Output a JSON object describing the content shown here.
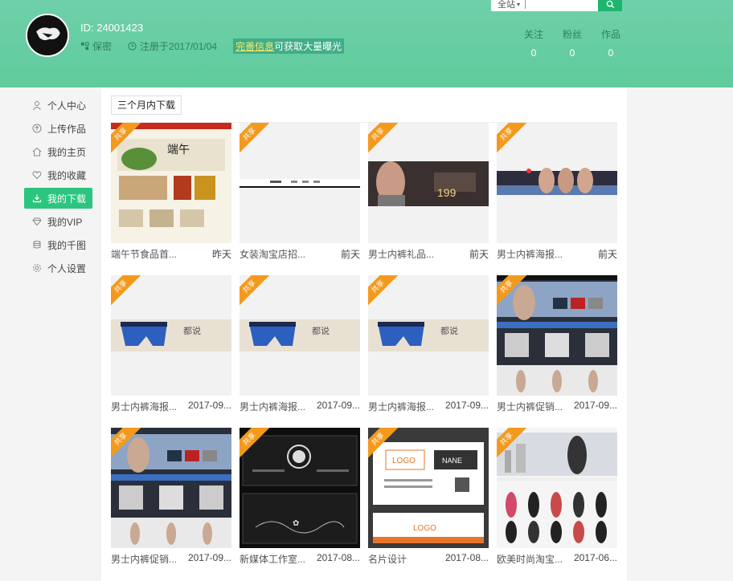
{
  "header": {
    "user_id": "ID: 24001423",
    "gender": "保密",
    "registered": "注册于2017/01/04",
    "promo_link": "完善信息",
    "promo_text": "可获取大量曝光",
    "search_placeholder": "全站",
    "stats": [
      {
        "label": "关注",
        "value": "0"
      },
      {
        "label": "粉丝",
        "value": "0"
      },
      {
        "label": "作品",
        "value": "0"
      }
    ]
  },
  "sidebar": {
    "items": [
      {
        "label": "个人中心",
        "icon": "user-icon"
      },
      {
        "label": "上传作品",
        "icon": "upload-icon"
      },
      {
        "label": "我的主页",
        "icon": "home-icon"
      },
      {
        "label": "我的收藏",
        "icon": "heart-icon"
      },
      {
        "label": "我的下载",
        "icon": "download-icon",
        "active": true
      },
      {
        "label": "我的VIP",
        "icon": "diamond-icon"
      },
      {
        "label": "我的千图",
        "icon": "coins-icon"
      },
      {
        "label": "个人设置",
        "icon": "settings-icon"
      }
    ]
  },
  "main": {
    "filter_label": "三个月内下载",
    "ribbon_label": "共享",
    "cards": [
      {
        "title": "端午节食品首...",
        "date": "昨天"
      },
      {
        "title": "女装淘宝店招...",
        "date": "前天"
      },
      {
        "title": "男士内裤礼品...",
        "date": "前天"
      },
      {
        "title": "男士内裤海报...",
        "date": "前天"
      },
      {
        "title": "男士内裤海报...",
        "date": "2017-09..."
      },
      {
        "title": "男士内裤海报...",
        "date": "2017-09..."
      },
      {
        "title": "男士内裤海报...",
        "date": "2017-09..."
      },
      {
        "title": "男士内裤促销...",
        "date": "2017-09..."
      },
      {
        "title": "男士内裤促销...",
        "date": "2017-09..."
      },
      {
        "title": "新媒体工作室...",
        "date": "2017-08..."
      },
      {
        "title": "名片设计",
        "date": "2017-08..."
      },
      {
        "title": "欧美时尚淘宝...",
        "date": "2017-06..."
      }
    ]
  },
  "colors": {
    "header_green": "#5fcb9d",
    "active_green": "#2cc57f",
    "ribbon_orange": "#f39a1e",
    "promo_yellow": "#ffe86a"
  }
}
